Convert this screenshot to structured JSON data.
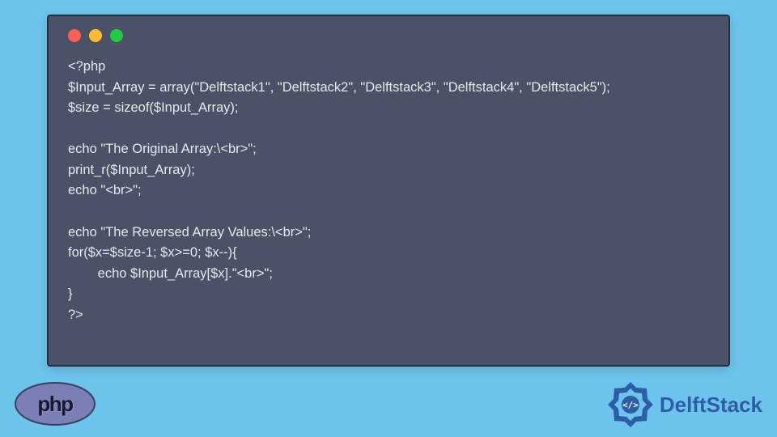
{
  "code": {
    "line1": "<?php",
    "line2": "$Input_Array = array(\"Delftstack1\", \"Delftstack2\", \"Delftstack3\", \"Delftstack4\", \"Delftstack5\");",
    "line3": "$size = sizeof($Input_Array);",
    "line4": "",
    "line5": "echo \"The Original Array:\\<br>\";",
    "line6": "print_r($Input_Array);",
    "line7": "echo \"<br>\";",
    "line8": "",
    "line9": "echo \"The Reversed Array Values:\\<br>\";",
    "line10": "for($x=$size-1; $x>=0; $x--){",
    "line11": "        echo $Input_Array[$x].\"<br>\";",
    "line12": "}",
    "line13": "?>"
  },
  "logos": {
    "php": "php",
    "delftstack": "DelftStack"
  },
  "colors": {
    "background": "#6cc4ed",
    "window": "#4b5267",
    "php_fill": "#7a7fb5",
    "delft_blue": "#2e5da8"
  }
}
